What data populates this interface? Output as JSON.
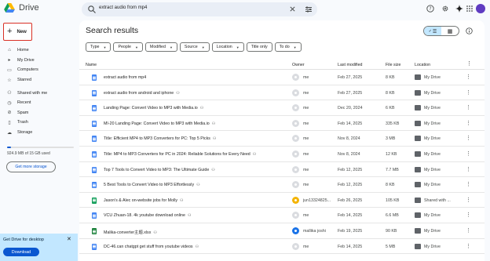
{
  "app": {
    "name": "Drive"
  },
  "search": {
    "query": "extract audio from mp4"
  },
  "sidebar": {
    "new_label": "New",
    "items": [
      {
        "label": "Home",
        "icon": "home-icon",
        "glyph": "⌂"
      },
      {
        "label": "My Drive",
        "icon": "my-drive-icon",
        "glyph": "▸"
      },
      {
        "label": "Computers",
        "icon": "computers-icon",
        "glyph": "▭"
      },
      {
        "label": "Starred",
        "icon": "star-icon",
        "glyph": "☆"
      },
      {
        "label": "Shared with me",
        "icon": "shared-icon",
        "glyph": "⚇"
      },
      {
        "label": "Recent",
        "icon": "clock-icon",
        "glyph": "◷"
      },
      {
        "label": "Spam",
        "icon": "spam-icon",
        "glyph": "⊘"
      },
      {
        "label": "Trash",
        "icon": "trash-icon",
        "glyph": "▯"
      },
      {
        "label": "Storage",
        "icon": "cloud-icon",
        "glyph": "☁"
      }
    ],
    "storage_text": "924.9 MB of 15 GB used",
    "storage_used_fraction": 0.06,
    "get_more_storage": "Get more storage",
    "desktop_card": {
      "text": "Get Drive for desktop",
      "download": "Download"
    }
  },
  "main": {
    "title": "Search results",
    "filters": [
      "Type",
      "People",
      "Modified",
      "Source",
      "Location",
      "Title only",
      "To do"
    ],
    "columns": {
      "name": "Name",
      "owner": "Owner",
      "modified": "Last modified",
      "size": "File size",
      "location": "Location"
    },
    "rows": [
      {
        "name": "extract audio from mp4",
        "shared": false,
        "owner": "me",
        "modified": "Feb 27, 2025",
        "size": "8 KB",
        "location": "My Drive",
        "type": "doc"
      },
      {
        "name": "extract audio from android and iphone",
        "shared": true,
        "owner": "me",
        "modified": "Feb 27, 2025",
        "size": "8 KB",
        "location": "My Drive",
        "type": "doc"
      },
      {
        "name": "Landing Page: Convert Video to MP3 with Media.io",
        "shared": true,
        "owner": "me",
        "modified": "Dec 20, 2024",
        "size": "6 KB",
        "location": "My Drive",
        "type": "doc"
      },
      {
        "name": "MI-20 Landing Page: Convert Video to MP3 with Media.io",
        "shared": true,
        "owner": "me",
        "modified": "Feb 14, 2025",
        "size": "335 KB",
        "location": "My Drive",
        "type": "doc"
      },
      {
        "name": "Title: Efficient MP4 to MP3 Converters for PC: Top 5 Picks",
        "shared": true,
        "owner": "me",
        "modified": "Nov 8, 2024",
        "size": "3 MB",
        "location": "My Drive",
        "type": "doc"
      },
      {
        "name": "Title: MP4 to MP3 Converters for PC in 2024: Reliable Solutions for Every Need",
        "shared": true,
        "owner": "me",
        "modified": "Nov 8, 2024",
        "size": "12 KB",
        "location": "My Drive",
        "type": "doc"
      },
      {
        "name": "Top 7 Tools to Convert Video to MP3: The Ultimate Guide",
        "shared": true,
        "owner": "me",
        "modified": "Feb 12, 2025",
        "size": "7.7 MB",
        "location": "My Drive",
        "type": "doc"
      },
      {
        "name": "5 Best Tools to Convert Video to MP3 Effortlessly",
        "shared": true,
        "owner": "me",
        "modified": "Feb 12, 2025",
        "size": "8 KB",
        "location": "My Drive",
        "type": "doc"
      },
      {
        "name": "Jason's & Alec on-website jobs for Molly",
        "shared": true,
        "owner": "jun13324825...",
        "modified": "Feb 26, 2025",
        "size": "105 KB",
        "location": "Shared with ...",
        "type": "sheet"
      },
      {
        "name": "VCU Zhuan-18. 4k youtube download online",
        "shared": true,
        "owner": "me",
        "modified": "Feb 14, 2025",
        "size": "6.6 MB",
        "location": "My Drive",
        "type": "doc"
      },
      {
        "name": "Malika-converter主题.xlsx",
        "shared": true,
        "owner": "mallika joshi",
        "modified": "Feb 19, 2025",
        "size": "90 KB",
        "location": "My Drive",
        "type": "xlsx"
      },
      {
        "name": "DC-46.can chatgpt get stuff from youtube videos",
        "shared": true,
        "owner": "me",
        "modified": "Feb 14, 2025",
        "size": "5 MB",
        "location": "My Drive",
        "type": "doc"
      }
    ]
  },
  "colors": {
    "doc": "#4285f4",
    "sheet": "#0f9d58",
    "xlsx": "#188038",
    "accent": "#0b57d0"
  }
}
